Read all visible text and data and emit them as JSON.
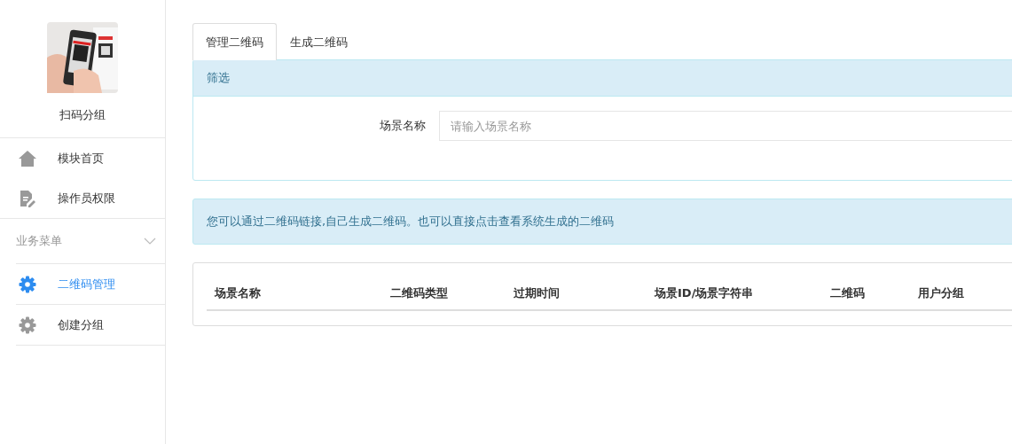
{
  "sidebar": {
    "profile": {
      "kind": "picture",
      "name": "扫码分组"
    },
    "items": [
      {
        "label": "模块首页",
        "kind": "home",
        "selected": false
      },
      {
        "label": "操作员权限",
        "kind": "document",
        "selected": false
      }
    ],
    "group": {
      "label": "业务菜单",
      "expanded": true,
      "children": [
        {
          "label": "二维码管理",
          "kind": "gear",
          "selected": true
        },
        {
          "label": "创建分组",
          "kind": "gear",
          "selected": false
        }
      ]
    }
  },
  "tabs": [
    {
      "label": "管理二维码",
      "selected": true
    },
    {
      "label": "生成二维码",
      "selected": false
    }
  ],
  "filter": {
    "title": "筛选",
    "field_label": "场景名称",
    "placeholder": "请输入场景名称"
  },
  "notice": "您可以通过二维码链接,自己生成二维码。也可以直接点击查看系统生成的二维码",
  "table": {
    "columns": [
      "场景名称",
      "二维码类型",
      "过期时间",
      "场景ID/场景字符串",
      "二维码",
      "用户分组"
    ]
  }
}
